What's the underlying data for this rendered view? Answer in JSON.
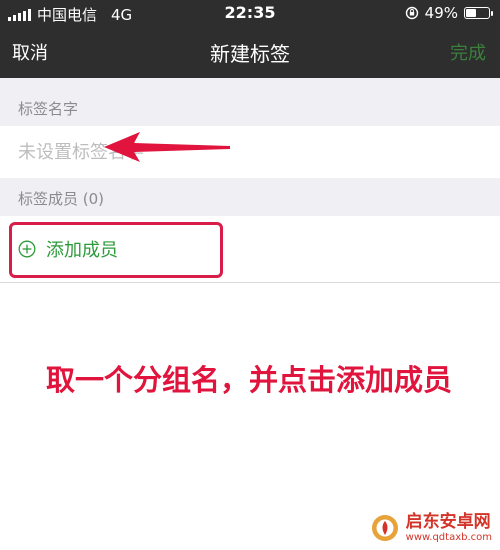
{
  "status_bar": {
    "carrier": "中国电信",
    "network": "4G",
    "time": "22:35",
    "battery": "49%",
    "battery_level": 0.49
  },
  "nav": {
    "cancel_label": "取消",
    "title": "新建标签",
    "done_label": "完成"
  },
  "form": {
    "name_section_label": "标签名字",
    "name_placeholder": "未设置标签名字",
    "members_section_label": "标签成员 (0)",
    "add_member_label": "添加成员"
  },
  "annotation": {
    "text": "取一个分组名，并点击添加成员"
  },
  "watermark": {
    "name": "启东安卓网",
    "url": "www.qdtaxb.com"
  },
  "colors": {
    "nav_bg": "#2e2e2e",
    "done": "#3c7f3d",
    "accent_green": "#2f9a3b",
    "annotation_red": "#e0143c"
  }
}
